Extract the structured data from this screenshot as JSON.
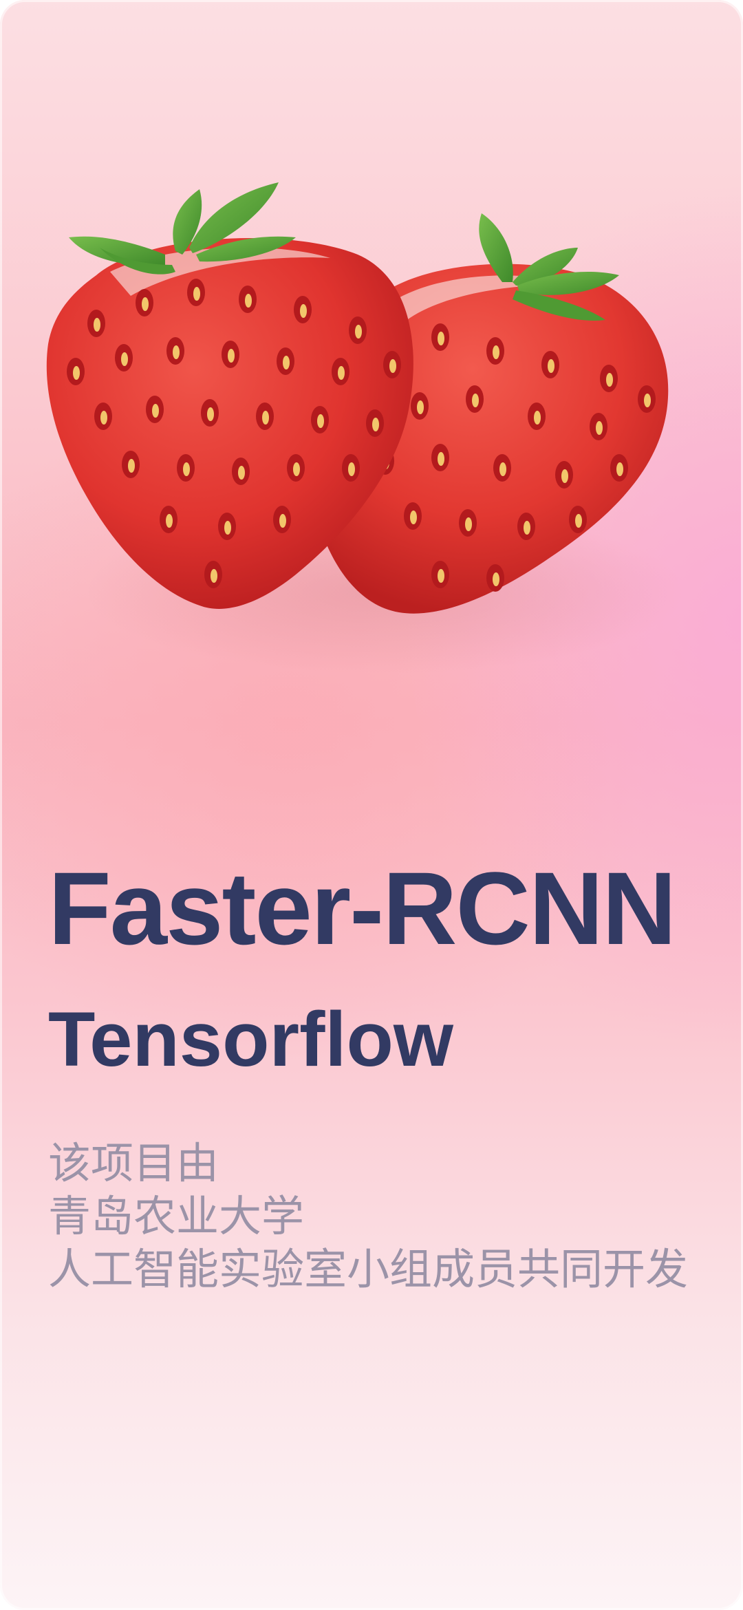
{
  "hero": {
    "image": "strawberry-illustration",
    "colors": {
      "berry": "#e5352f",
      "berry_dark": "#b91f1e",
      "leaf": "#5aa53a",
      "seed": "#f2c66b"
    }
  },
  "title": "Faster-RCNN",
  "subtitle": "Tensorflow",
  "credits": [
    "该项目由",
    "青岛农业大学",
    "人工智能实验室小组成员共同开发"
  ],
  "colors": {
    "title": "#323a63",
    "credits": "#9b93a8",
    "background_top": "#fcdfe3",
    "background_mid": "#fab6c0",
    "background_bottom": "#fdf4f6"
  }
}
